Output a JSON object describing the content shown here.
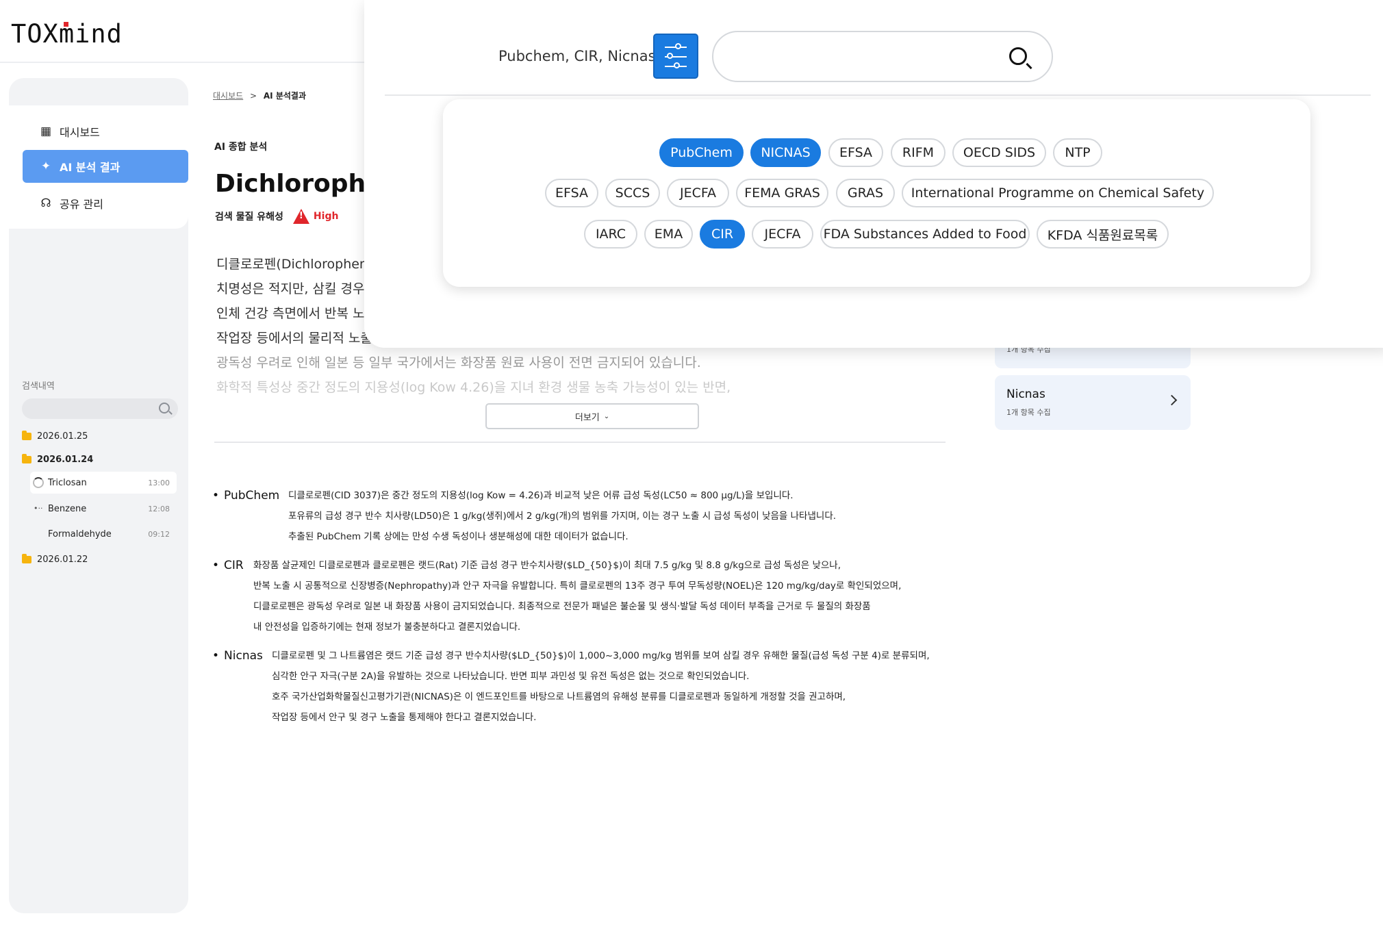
{
  "app": {
    "logo": "TOXmind"
  },
  "sidebar": {
    "items": [
      {
        "label": "대시보드"
      },
      {
        "label": "AI 분석 결과"
      },
      {
        "label": "공유 관리"
      }
    ],
    "history": {
      "title": "검색내역",
      "folders": [
        {
          "date": "2026.01.25"
        },
        {
          "date": "2026.01.24"
        },
        {
          "date": "2026.01.22"
        }
      ],
      "entries": [
        {
          "name": "Triclosan",
          "time": "13:00"
        },
        {
          "name": "Benzene",
          "time": "12:08"
        },
        {
          "name": "Formaldehyde",
          "time": "09:12"
        }
      ]
    }
  },
  "main": {
    "breadcrumb": {
      "root": "대시보드",
      "sep": ">",
      "current": "AI 분석결과"
    },
    "section_title": "AI 종합 분석",
    "chemical_name": "Dichlorophene",
    "hazard_label": "검색 물질 유해성",
    "hazard_level": "High",
    "summary_lines": [
      "디클로로펜(Dichlorophene",
      "치명성은 적지만, 삼킬 경우",
      "인체 건강 측면에서 반복 노출",
      "작업장 등에서의 물리적 노출",
      "광독성 우려로 인해 일본 등 일부 국가에서는 화장품 원료 사용이 전면 금지되어 있습니다.",
      "화학적 특성상 중간 정도의 지용성(log Kow 4.26)을 지녀 환경 생물 농축 가능성이 있는 반면,"
    ],
    "more_button": "더보기",
    "sources": [
      {
        "label": "PubChem",
        "lines": [
          "디클로로펜(CID 3037)은 중간 정도의 지용성(log Kow = 4.26)과 비교적 낮은 어류 급성 독성(LC50 ≈ 800 μg/L)을 보입니다.",
          "포유류의 급성 경구 반수 치사량(LD50)은 1 g/kg(생쥐)에서 2 g/kg(개)의 범위를 가지며, 이는 경구 노출 시 급성 독성이 낮음을 나타냅니다.",
          "추출된 PubChem 기록 상에는 만성 수생 독성이나 생분해성에 대한 데이터가 없습니다."
        ]
      },
      {
        "label": "CIR",
        "lines": [
          "화장품 살균제인 디클로로펜과 클로로펜은 랫드(Rat) 기준 급성 경구 반수치사량($LD_{50}$)이 최대 7.5 g/kg 및 8.8 g/kg으로 급성 독성은 낮으나,",
          "반복 노출 시 공통적으로 신장병증(Nephropathy)과 안구 자극을 유발합니다. 특히 클로로펜의 13주 경구 투여 무독성량(NOEL)은 120 mg/kg/day로 확인되었으며,",
          "디클로로펜은 광독성 우려로 일본 내 화장품 사용이 금지되었습니다.  최종적으로 전문가 패널은 불순물 및 생식·발달 독성 데이터 부족을 근거로 두 물질의 화장품",
          "내 안전성을 입증하기에는 현재 정보가 불충분하다고 결론지었습니다."
        ]
      },
      {
        "label": "Nicnas",
        "lines": [
          "디클로로펜 및 그 나트륨염은 랫드 기준 급성 경구 반수치사량($LD_{50}$)이 1,000~3,000 mg/kg 범위를 보여 삼킬 경우 유해한 물질(급성 독성 구분 4)로 분류되며,",
          "심각한 안구 자극(구분 2A)을 유발하는 것으로 나타났습니다. 반면 피부 과민성 및 유전 독성은 없는 것으로 확인되었습니다.",
          "호주 국가산업화학물질신고평가기관(NICNAS)은 이 엔드포인트를 바탕으로 나트륨염의 유해성 분류를 디클로로펜과 동일하게 개정할 것을 권고하며,",
          "작업장 등에서 안구 및 경구 노출을 통제해야 한다고 결론지었습니다."
        ]
      }
    ]
  },
  "right_cards": [
    {
      "name": "",
      "count": "1개 항목 수집"
    },
    {
      "name": "Nicnas",
      "count": "1개 항목 수집"
    }
  ],
  "search_overlay": {
    "selected_sources": "Pubchem, CIR, Nicnas",
    "search_value": "",
    "chips": [
      {
        "label": "PubChem",
        "selected": true
      },
      {
        "label": "NICNAS",
        "selected": true
      },
      {
        "label": "EFSA",
        "selected": false
      },
      {
        "label": "RIFM",
        "selected": false
      },
      {
        "label": "OECD SIDS",
        "selected": false
      },
      {
        "label": "NTP",
        "selected": false
      },
      {
        "label": "EFSA",
        "selected": false
      },
      {
        "label": "SCCS",
        "selected": false
      },
      {
        "label": "JECFA",
        "selected": false
      },
      {
        "label": "FEMA GRAS",
        "selected": false
      },
      {
        "label": "GRAS",
        "selected": false
      },
      {
        "label": "International Programme on Chemical Safety",
        "selected": false
      },
      {
        "label": "IARC",
        "selected": false
      },
      {
        "label": "EMA",
        "selected": false
      },
      {
        "label": "CIR",
        "selected": true
      },
      {
        "label": "JECFA",
        "selected": false
      },
      {
        "label": "FDA Substances Added to Food",
        "selected": false
      },
      {
        "label": "KFDA 식품원료목록",
        "selected": false
      }
    ]
  },
  "colors": {
    "accent": "#1a7be0",
    "sidebar_active": "#5b9bf1",
    "danger": "#e0262b",
    "folder": "#f6b40e"
  }
}
